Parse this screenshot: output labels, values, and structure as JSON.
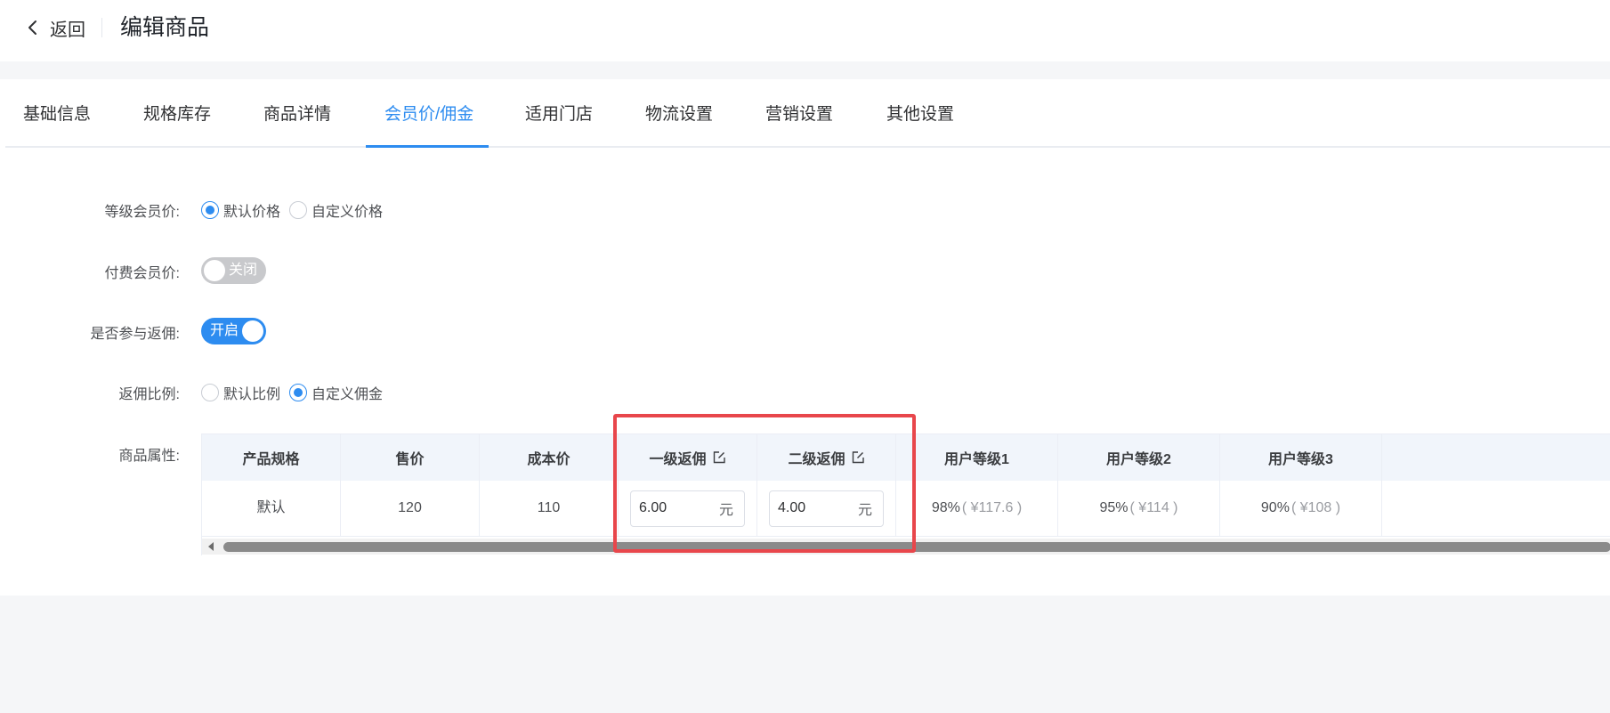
{
  "header": {
    "back_label": "返回",
    "title": "编辑商品"
  },
  "tabs": [
    {
      "label": "基础信息",
      "active": false
    },
    {
      "label": "规格库存",
      "active": false
    },
    {
      "label": "商品详情",
      "active": false
    },
    {
      "label": "会员价/佣金",
      "active": true
    },
    {
      "label": "适用门店",
      "active": false
    },
    {
      "label": "物流设置",
      "active": false
    },
    {
      "label": "营销设置",
      "active": false
    },
    {
      "label": "其他设置",
      "active": false
    }
  ],
  "form": {
    "member_price": {
      "label": "等级会员价:",
      "options": [
        "默认价格",
        "自定义价格"
      ],
      "selected": "默认价格"
    },
    "paid_member_price": {
      "label": "付费会员价:",
      "switch_text": "关闭",
      "on": false
    },
    "commission": {
      "label": "是否参与返佣:",
      "switch_text": "开启",
      "on": true
    },
    "commission_ratio": {
      "label": "返佣比例:",
      "options": [
        "默认比例",
        "自定义佣金"
      ],
      "selected": "自定义佣金"
    },
    "attributes": {
      "label": "商品属性:"
    }
  },
  "table": {
    "columns": [
      "产品规格",
      "售价",
      "成本价",
      "一级返佣",
      "二级返佣",
      "用户等级1",
      "用户等级2",
      "用户等级3"
    ],
    "row": {
      "spec": "默认",
      "price": "120",
      "cost": "110",
      "level1_commission": "6.00",
      "level2_commission": "4.00",
      "unit": "元",
      "user_level_1": {
        "percent": "98%",
        "price": "( ¥117.6 )"
      },
      "user_level_2": {
        "percent": "95%",
        "price": "( ¥114 )"
      },
      "user_level_3": {
        "percent": "90%",
        "price": "( ¥108 )"
      }
    }
  },
  "colors": {
    "accent": "#2d8cf0",
    "highlight": "#e8464b"
  }
}
